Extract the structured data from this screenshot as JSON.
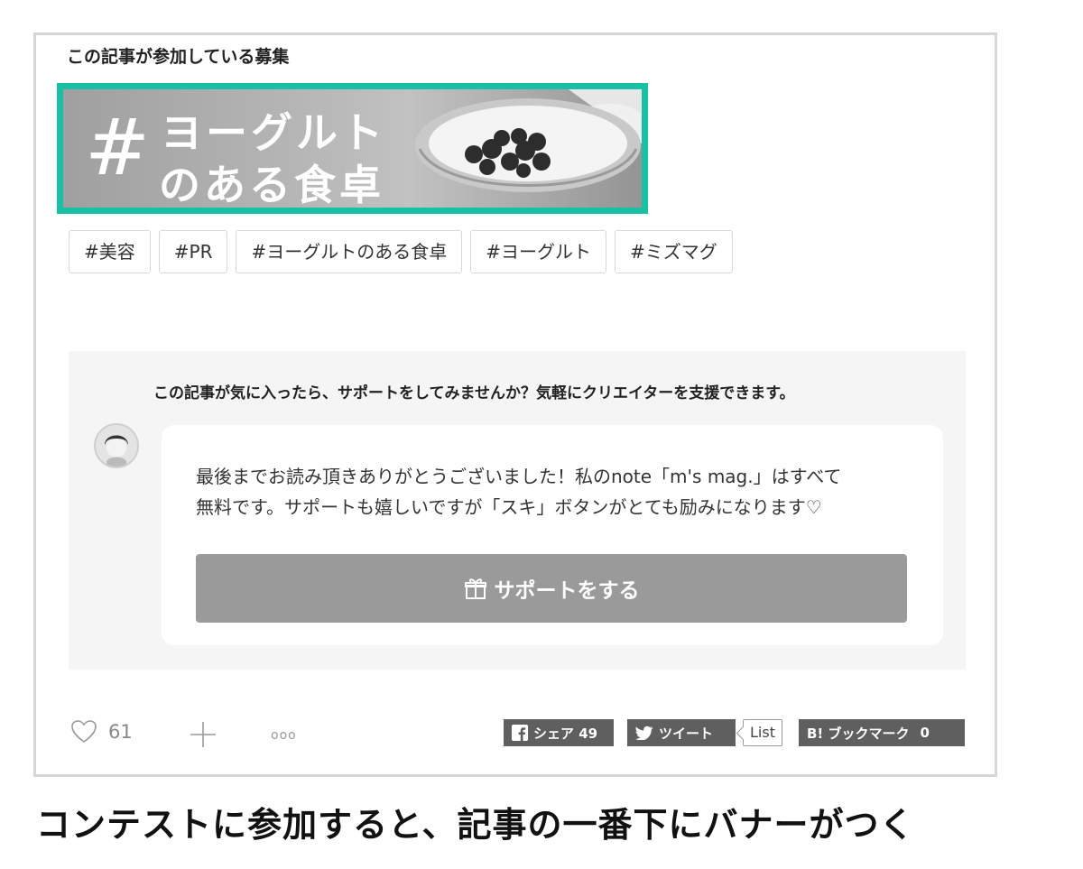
{
  "contest": {
    "heading": "この記事が参加している募集",
    "banner": {
      "hash": "#",
      "line1": "ヨーグルト",
      "line2": "のある食卓"
    }
  },
  "tags": [
    "#美容",
    "#PR",
    "#ヨーグルトのある食卓",
    "#ヨーグルト",
    "#ミズマグ"
  ],
  "support": {
    "prompt": "この記事が気に入ったら、サポートをしてみませんか？気軽にクリエイターを支援できます。",
    "message_line1": "最後までお読み頂きありがとうございました！私のnote「m's mag.」はすべて",
    "message_line2": "無料です。サポートも嬉しいですが「スキ」ボタンがとても励みになります♡",
    "button_label": "サポートをする"
  },
  "actions": {
    "like_count": "61",
    "more": "ooo",
    "facebook_label": "シェア 49",
    "tweet_label": "ツイート",
    "list_label": "List",
    "hatena_label": "B! ブックマーク",
    "hatena_count": "0"
  },
  "caption": "コンテストに参加すると、記事の一番下にバナーがつく"
}
